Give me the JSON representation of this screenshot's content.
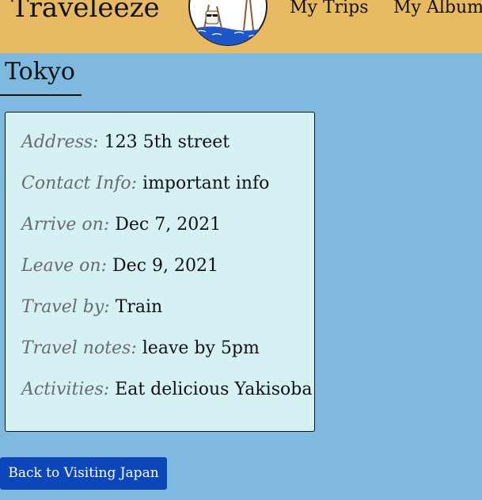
{
  "header": {
    "brand": "Traveleeze",
    "logo_icon": "beach-chair-logo-icon",
    "nav": [
      "My Trips",
      "My Albums"
    ]
  },
  "page": {
    "title": "Tokyo"
  },
  "details": [
    {
      "label": "Address:",
      "value": "123 5th street"
    },
    {
      "label": "Contact Info:",
      "value": "important info"
    },
    {
      "label": "Arrive on:",
      "value": "Dec 7, 2021"
    },
    {
      "label": "Leave on:",
      "value": "Dec 9, 2021"
    },
    {
      "label": "Travel by:",
      "value": "Train"
    },
    {
      "label": "Travel notes:",
      "value": "leave by 5pm"
    },
    {
      "label": "Activities:",
      "value": "Eat delicious Yakisoba"
    }
  ],
  "actions": {
    "back_label": "Back to Visiting Japan"
  },
  "colors": {
    "header_bg": "#e6b962",
    "page_bg": "#7fb9df",
    "card_bg": "#d5f1f3",
    "button_bg": "#0d46b9"
  }
}
